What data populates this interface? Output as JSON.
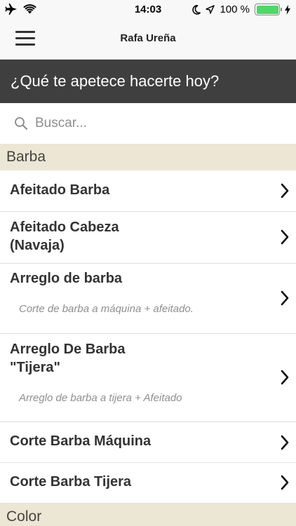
{
  "status_bar": {
    "time": "14:03",
    "battery": "100 %",
    "battery_level": 1.0
  },
  "nav": {
    "title": "Rafa Ureña"
  },
  "hero": {
    "text": "¿Qué te apetece hacerte hoy?"
  },
  "search": {
    "placeholder": "Buscar..."
  },
  "sections": [
    {
      "label": "Barba"
    },
    {
      "label": "Color"
    }
  ],
  "services": [
    {
      "title": "Afeitado Barba",
      "description": ""
    },
    {
      "title": "Afeitado Cabeza\n(Navaja)",
      "description": ""
    },
    {
      "title": "Arreglo de barba",
      "description": "Corte de barba a máquina + afeitado."
    },
    {
      "title": "Arreglo De Barba\n\"Tijera\"",
      "description": "Arreglo de barba a tijera + Afeitado"
    },
    {
      "title": "Corte Barba Máquina",
      "description": ""
    },
    {
      "title": "Corte Barba Tijera",
      "description": ""
    }
  ],
  "colors": {
    "hero_bg": "#3f3f3f",
    "section_bg": "#ece6d4",
    "battery_green": "#4cd964"
  },
  "icons": [
    "airplane-icon",
    "wifi-icon",
    "moon-icon",
    "location-arrow-icon",
    "battery-icon",
    "charging-bolt-icon",
    "hamburger-menu-icon",
    "search-icon",
    "chevron-right-icon"
  ]
}
